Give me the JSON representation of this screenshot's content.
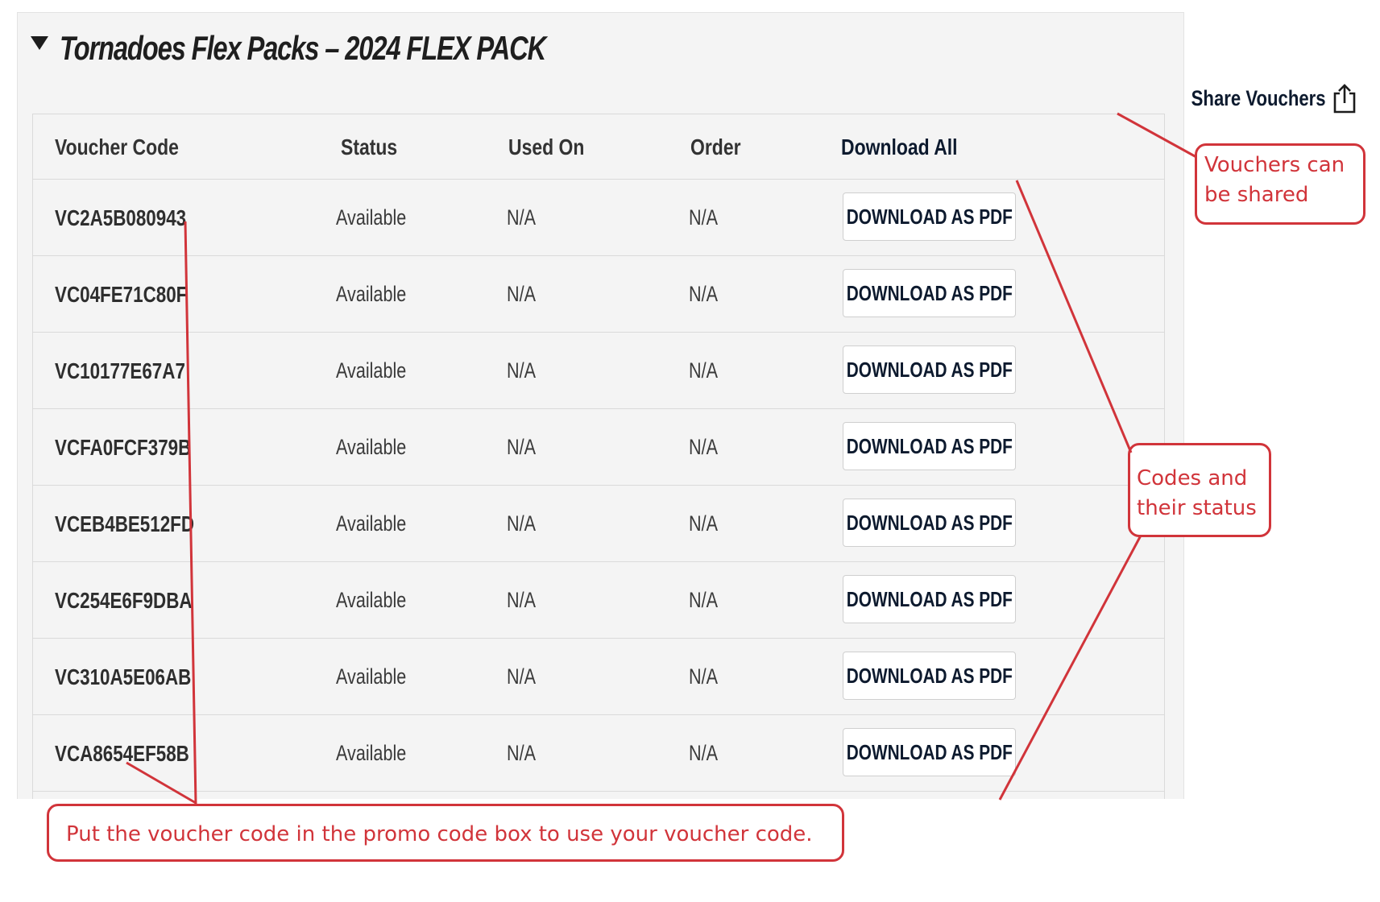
{
  "section": {
    "title": "Tornadoes Flex Packs – 2024 FLEX PACK"
  },
  "share": {
    "label": "Share Vouchers",
    "icon": "share-icon"
  },
  "table": {
    "headers": [
      "Voucher Code",
      "Status",
      "Used On",
      "Order",
      "Download All"
    ],
    "rows": [
      {
        "code": "VC2A5B080943",
        "status": "Available",
        "used_on": "N/A",
        "order": "N/A",
        "action": "DOWNLOAD AS PDF"
      },
      {
        "code": "VC04FE71C80F",
        "status": "Available",
        "used_on": "N/A",
        "order": "N/A",
        "action": "DOWNLOAD AS PDF"
      },
      {
        "code": "VC10177E67A7",
        "status": "Available",
        "used_on": "N/A",
        "order": "N/A",
        "action": "DOWNLOAD AS PDF"
      },
      {
        "code": "VCFA0FCF379B",
        "status": "Available",
        "used_on": "N/A",
        "order": "N/A",
        "action": "DOWNLOAD AS PDF"
      },
      {
        "code": "VCEB4BE512FD",
        "status": "Available",
        "used_on": "N/A",
        "order": "N/A",
        "action": "DOWNLOAD AS PDF"
      },
      {
        "code": "VC254E6F9DBA",
        "status": "Available",
        "used_on": "N/A",
        "order": "N/A",
        "action": "DOWNLOAD AS PDF"
      },
      {
        "code": "VC310A5E06AB",
        "status": "Available",
        "used_on": "N/A",
        "order": "N/A",
        "action": "DOWNLOAD AS PDF"
      },
      {
        "code": "VCA8654EF58B",
        "status": "Available",
        "used_on": "N/A",
        "order": "N/A",
        "action": "DOWNLOAD AS PDF"
      }
    ]
  },
  "annotations": {
    "share_note": [
      "Vouchers can",
      "be shared"
    ],
    "codes_note": [
      "Codes and",
      "their status"
    ],
    "promo_note": "Put the voucher code in the promo code box to use your voucher code."
  },
  "colors": {
    "annotation": "#d1343a",
    "panel_bg": "#f4f4f4",
    "navy_text": "#0d1a2e"
  }
}
